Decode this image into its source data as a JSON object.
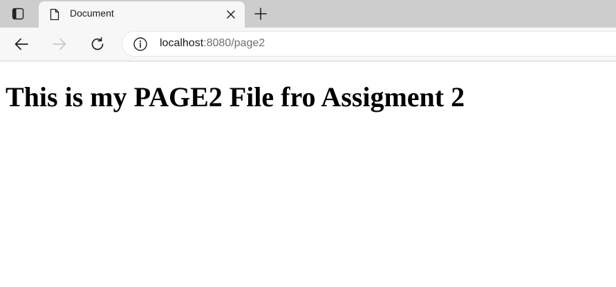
{
  "browser": {
    "tab": {
      "title": "Document",
      "favicon": "document-icon"
    },
    "tab_actions_icon": "tab-actions-icon",
    "close_icon": "close-icon",
    "new_tab_icon": "plus-icon",
    "nav": {
      "back_icon": "arrow-left-icon",
      "forward_icon": "arrow-right-icon",
      "forward_enabled": false,
      "reload_icon": "reload-icon"
    },
    "address_bar": {
      "info_icon": "info-icon",
      "host": "localhost",
      "rest": ":8080/page2"
    }
  },
  "page": {
    "heading": "This is my PAGE2 File fro Assigment 2"
  },
  "colors": {
    "tabbar_bg": "#cdcdcd",
    "toolbar_bg": "#f7f7f7",
    "url_secondary": "#6e6e6e",
    "disabled_icon": "#c8c8c8"
  }
}
